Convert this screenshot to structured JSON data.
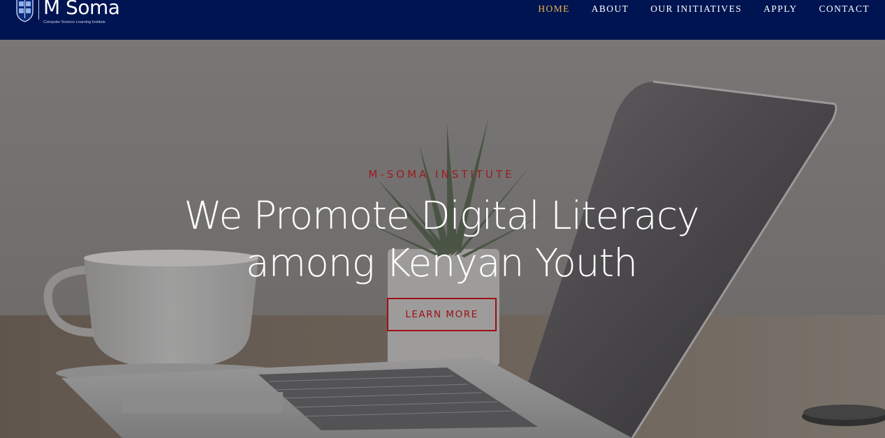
{
  "header": {
    "logo": {
      "title": "M Soma",
      "subtitle": "Computer Science Learning Institute"
    },
    "nav": [
      {
        "label": "HOME",
        "active": true
      },
      {
        "label": "ABOUT",
        "active": false
      },
      {
        "label": "OUR INITIATIVES",
        "active": false
      },
      {
        "label": "APPLY",
        "active": false
      },
      {
        "label": "CONTACT",
        "active": false
      }
    ]
  },
  "hero": {
    "eyebrow": "M-SOMA INSTITUTE",
    "headline_line1": "We Promote Digital Literacy",
    "headline_line2": "among Kenyan Youth",
    "cta_label": "LEARN MORE"
  },
  "colors": {
    "navbar": "#001451",
    "nav_active": "#e8b546",
    "accent_red": "#9c0f15",
    "text_white": "#ffffff"
  },
  "icons": {
    "logo_mark": "shield-crest-icon"
  }
}
